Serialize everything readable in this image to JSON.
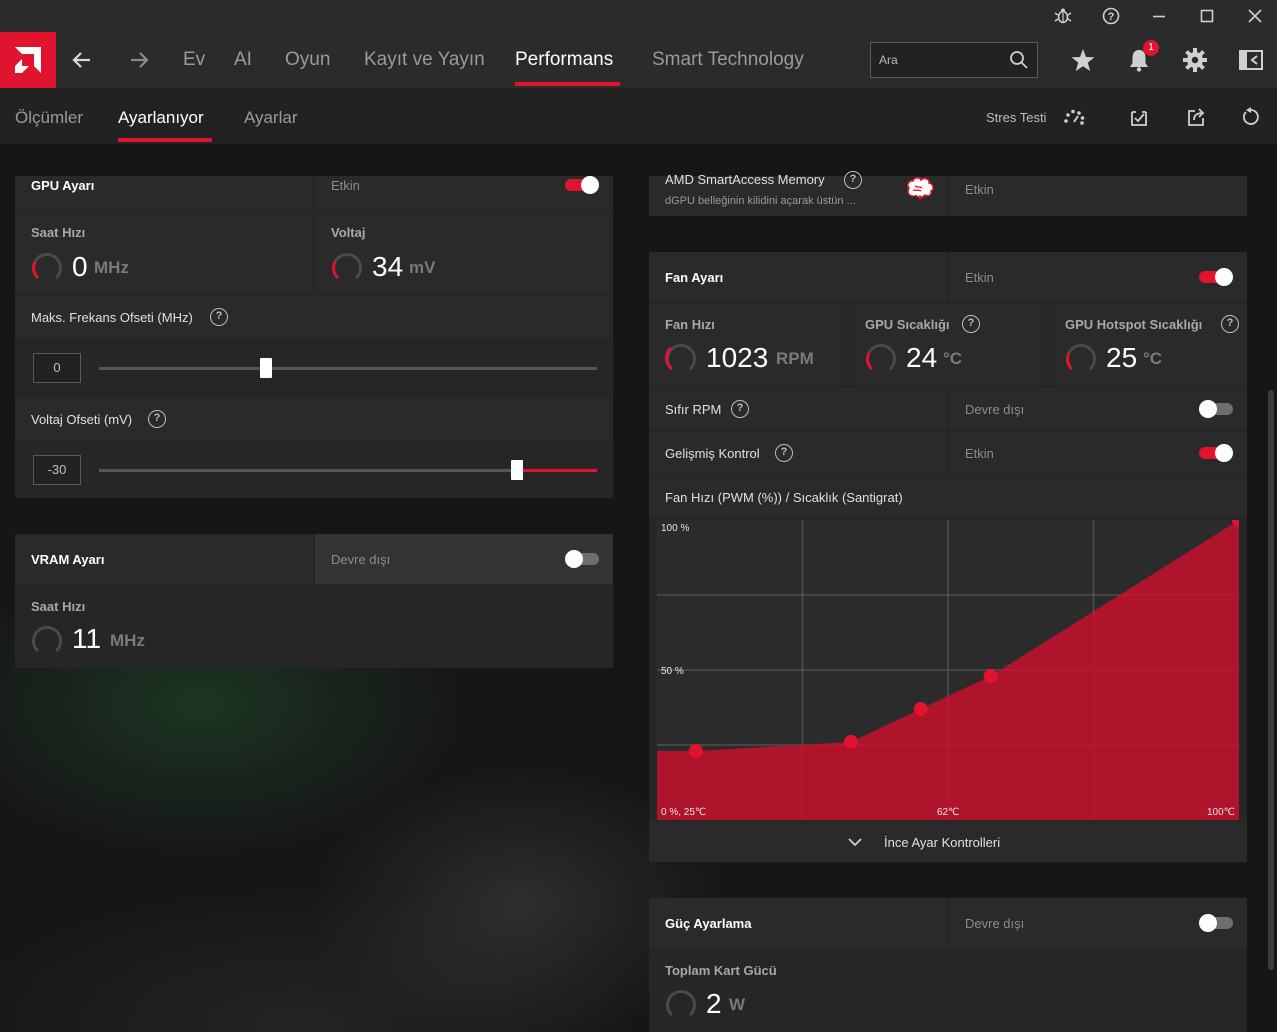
{
  "titlebar": {
    "icons": [
      "bug-icon",
      "help-icon",
      "minimize-icon",
      "maximize-icon",
      "close-icon"
    ]
  },
  "nav": {
    "items": [
      "Ev",
      "AI",
      "Oyun",
      "Kayıt ve Yayın",
      "Performans",
      "Smart Technology"
    ],
    "active": "Performans",
    "search_placeholder": "Ara",
    "notification_count": "1"
  },
  "subnav": {
    "items": [
      "Ölçümler",
      "Ayarlanıyor",
      "Ayarlar"
    ],
    "active": "Ayarlanıyor",
    "stress_test": "Stres Testi"
  },
  "gpu": {
    "title": "GPU Ayarı",
    "status": "Etkin",
    "enabled": true,
    "clock": {
      "label": "Saat Hızı",
      "value": "0",
      "unit": "MHz"
    },
    "voltage": {
      "label": "Voltaj",
      "value": "34",
      "unit": "mV"
    },
    "max_freq_offset": {
      "label": "Maks. Frekans Ofseti (MHz)",
      "value": "0",
      "slider_fraction": 0.335
    },
    "voltage_offset": {
      "label": "Voltaj Ofseti (mV)",
      "value": "-30",
      "slider_fraction": 0.84
    }
  },
  "vram": {
    "title": "VRAM Ayarı",
    "status": "Devre dışı",
    "enabled": false,
    "clock": {
      "label": "Saat Hızı",
      "value": "11",
      "unit": "MHz"
    }
  },
  "sam": {
    "title": "AMD SmartAccess Memory",
    "subtitle": "dGPU belleğinin kilidini açarak üstün ...",
    "status": "Etkin"
  },
  "fan": {
    "title": "Fan Ayarı",
    "status": "Etkin",
    "enabled": true,
    "speed": {
      "label": "Fan Hızı",
      "value": "1023",
      "unit": "RPM"
    },
    "gpu_temp": {
      "label": "GPU Sıcaklığı",
      "value": "24",
      "unit": "°C"
    },
    "hotspot_temp": {
      "label": "GPU Hotspot Sıcaklığı",
      "value": "25",
      "unit": "°C"
    },
    "zero_rpm": {
      "label": "Sıfır RPM",
      "status": "Devre dışı",
      "enabled": false
    },
    "advanced": {
      "label": "Gelişmiş Kontrol",
      "status": "Etkin",
      "enabled": true
    },
    "curve_title": "Fan Hızı (PWM (%)) / Sıcaklık (Santigrat)",
    "fine_tune": "İnce Ayar Kontrolleri"
  },
  "power": {
    "title": "Güç Ayarlama",
    "status": "Devre dışı",
    "enabled": false,
    "total": {
      "label": "Toplam Kart Gücü",
      "value": "2",
      "unit": "W"
    }
  },
  "chart_data": {
    "type": "area",
    "title": "Fan Hızı (PWM (%)) / Sıcaklık (Santigrat)",
    "xlim": [
      25,
      100
    ],
    "ylim": [
      0,
      100
    ],
    "y_tick_labels": [
      "100 %",
      "50 %"
    ],
    "origin_label": "0 %, 25℃",
    "x_tick_labels": [
      "62℃",
      "100℃"
    ],
    "x": [
      30,
      50,
      59,
      68,
      100
    ],
    "y": [
      23,
      26,
      37,
      48,
      100
    ],
    "color": "#c8102e",
    "grid": true
  }
}
